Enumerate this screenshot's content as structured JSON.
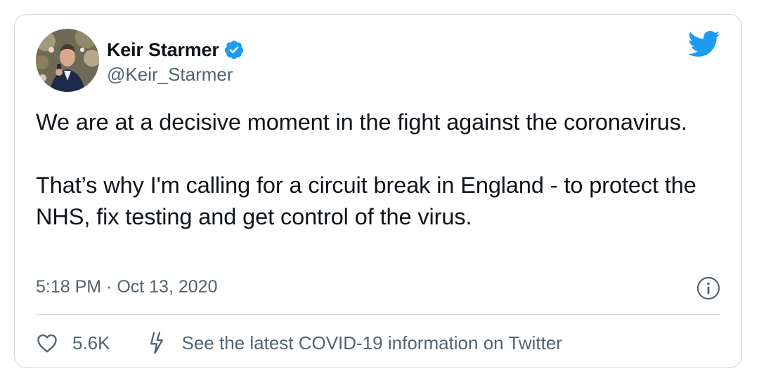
{
  "colors": {
    "text_primary": "#0f1419",
    "text_secondary": "#536471",
    "twitter_blue": "#1d9bf0",
    "border": "#cfd9de"
  },
  "author": {
    "display_name": "Keir Starmer",
    "handle": "@Keir_Starmer",
    "verified": true
  },
  "tweet": {
    "paragraphs": [
      "We are at a decisive moment in the fight against the coronavirus.",
      "That’s why I'm calling for a circuit break in England - to protect the NHS, fix testing and get control of the virus."
    ],
    "timestamp": "5:18 PM · Oct 13, 2020"
  },
  "actions": {
    "like_count": "5.6K",
    "covid_info_label": "See the latest COVID-19 information on Twitter"
  },
  "icons": {
    "logo": "twitter-bird-icon",
    "verified": "verified-badge-icon",
    "info": "info-icon",
    "like": "heart-icon",
    "covid": "lightning-bolt-icon"
  }
}
